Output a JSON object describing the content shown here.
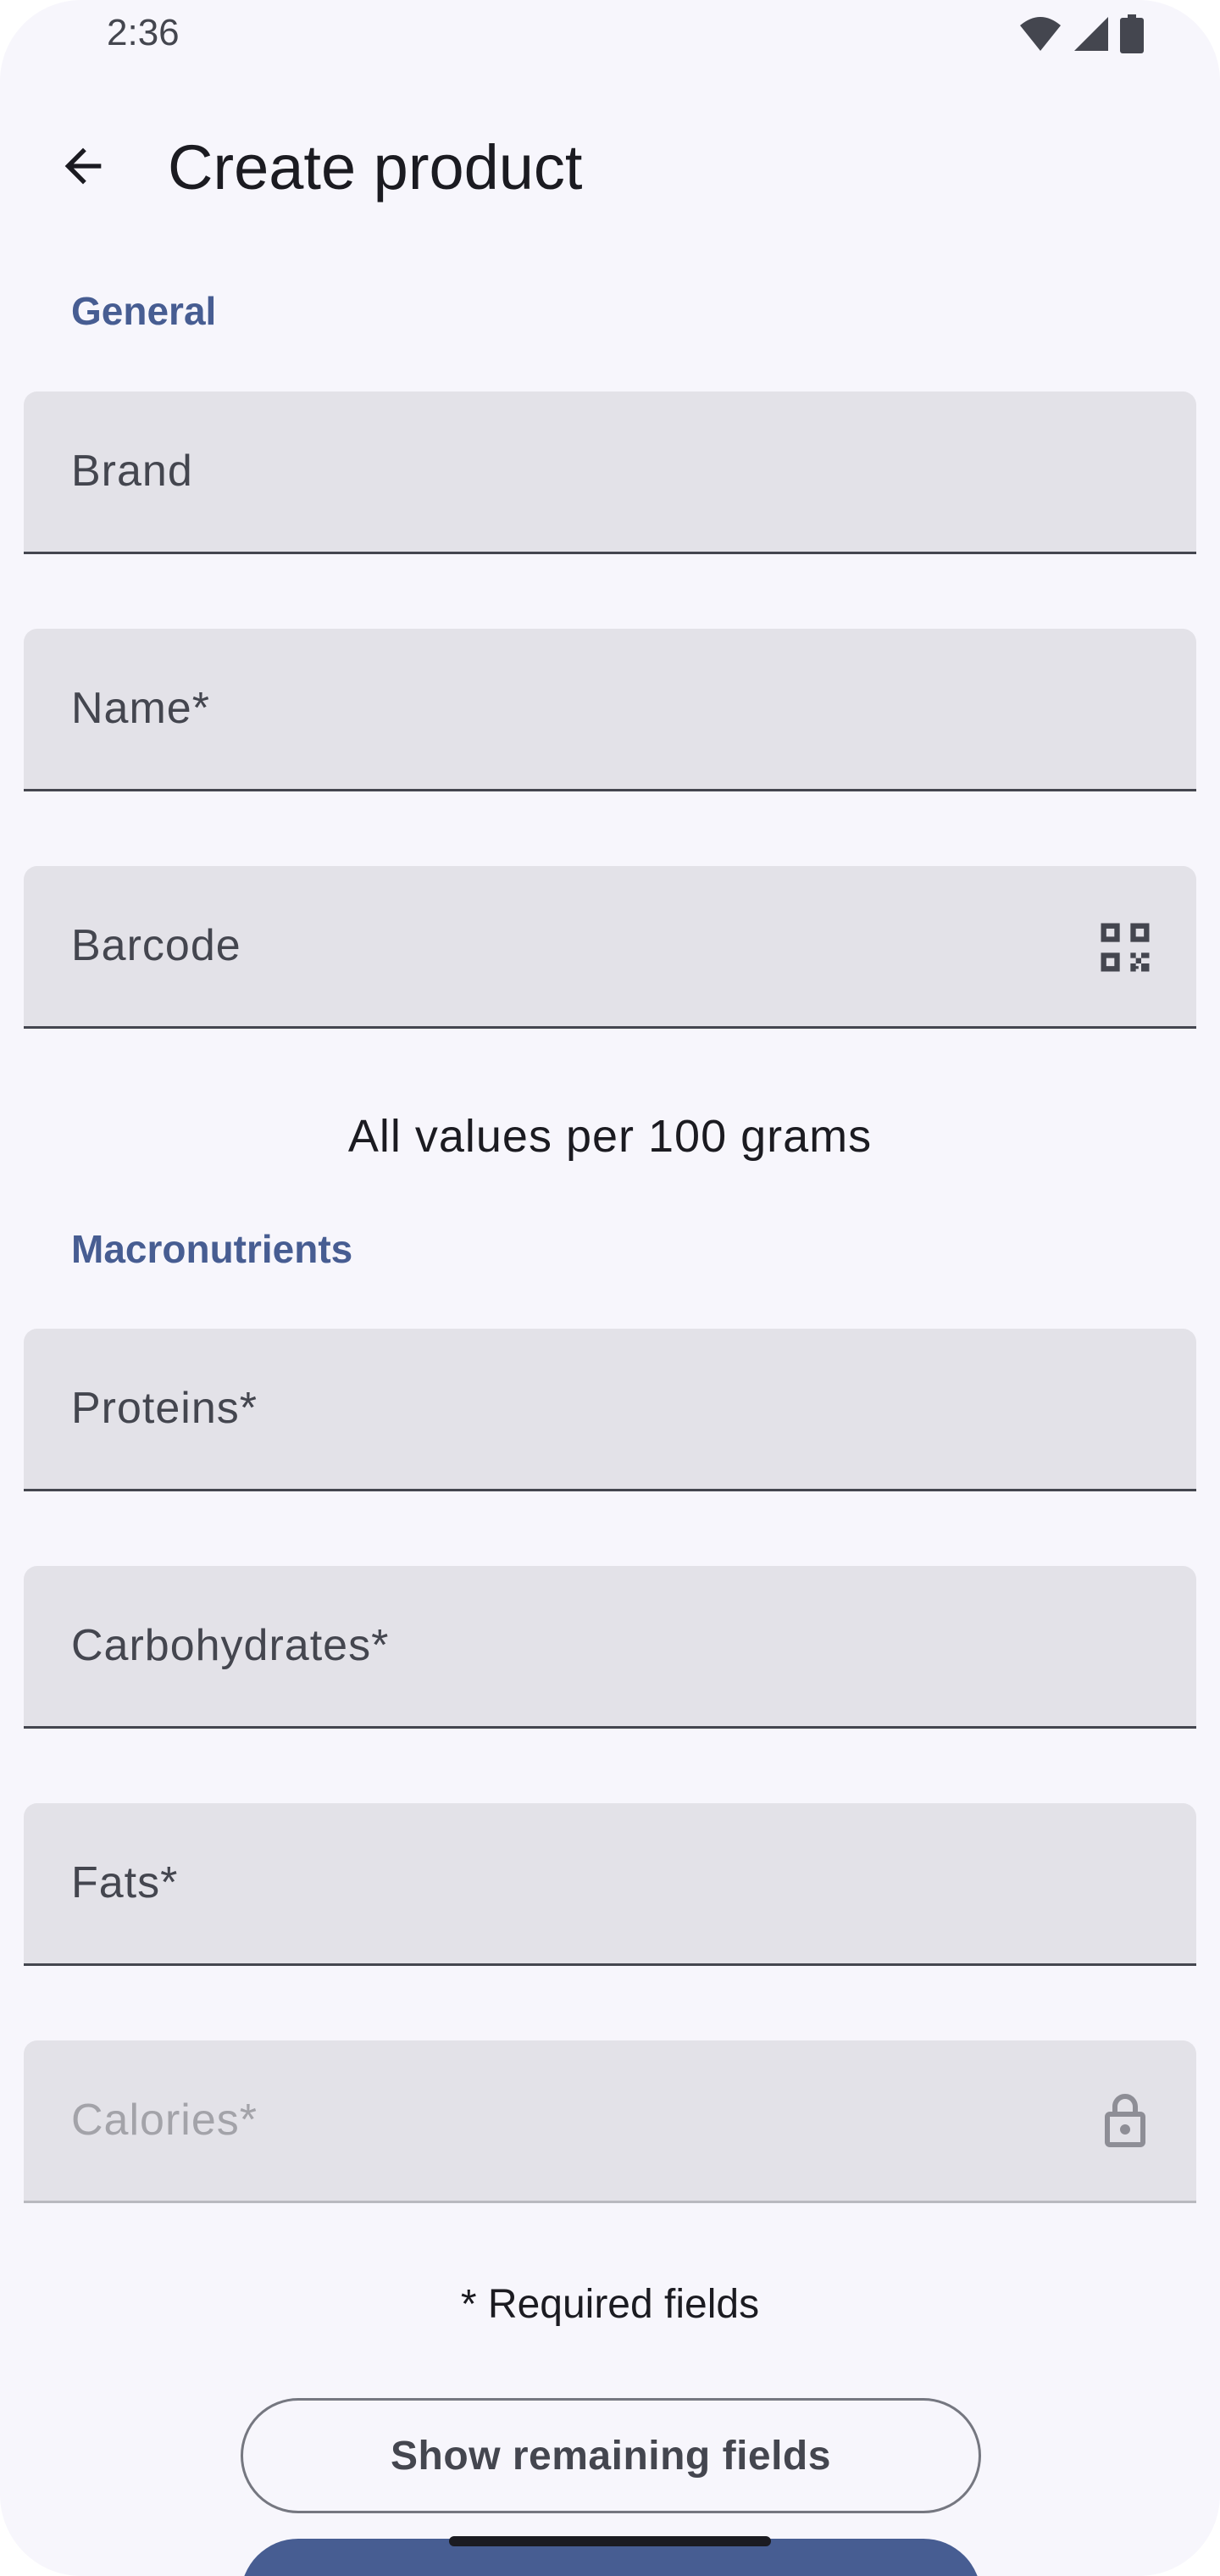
{
  "status_bar": {
    "time": "2:36",
    "icons": [
      "wifi-icon",
      "cellular-signal-icon",
      "battery-icon"
    ]
  },
  "top_bar": {
    "back_icon": "arrow-back-icon",
    "title": "Create product"
  },
  "sections": {
    "general_label": "General",
    "macronutrients_label": "Macronutrients"
  },
  "fields": {
    "brand": {
      "label": "Brand",
      "value": ""
    },
    "name": {
      "label": "Name*",
      "value": ""
    },
    "barcode": {
      "label": "Barcode",
      "value": "",
      "trailing_icon": "qr-code-scanner-icon"
    },
    "proteins": {
      "label": "Proteins*",
      "value": ""
    },
    "carbohydrates": {
      "label": "Carbohydrates*",
      "value": ""
    },
    "fats": {
      "label": "Fats*",
      "value": ""
    },
    "calories": {
      "label": "Calories*",
      "value": "",
      "trailing_icon": "lock-icon",
      "disabled": true
    }
  },
  "info_text": "All values per 100 grams",
  "required_note": "* Required fields",
  "buttons": {
    "show_remaining": "Show remaining fields"
  },
  "colors": {
    "accent": "#475d92",
    "background": "#f7f6fc",
    "field_fill": "#e3e2e8",
    "text_primary": "#1b1b21",
    "text_secondary": "#44464f"
  }
}
